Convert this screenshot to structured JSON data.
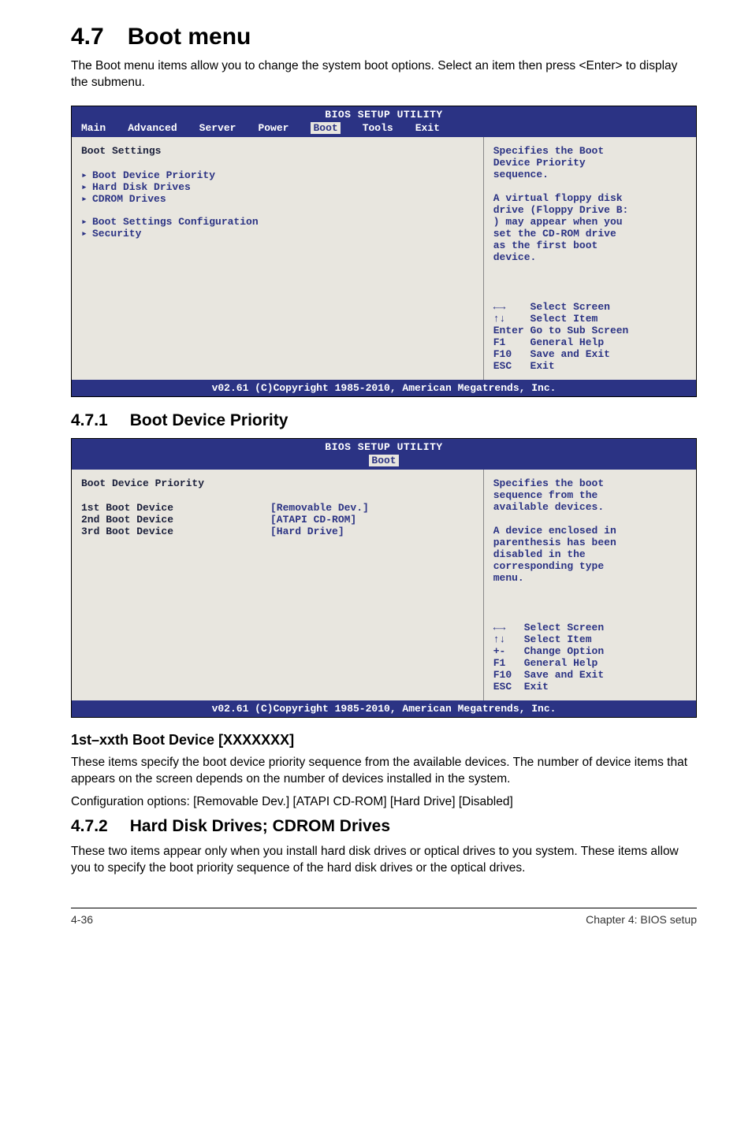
{
  "section": {
    "number": "4.7",
    "title": "Boot menu"
  },
  "intro": "The Boot menu items allow you to change the system boot options. Select an item then press <Enter> to display the submenu.",
  "bios1": {
    "title": "BIOS SETUP UTILITY",
    "tabs": [
      "Main",
      "Advanced",
      "Server",
      "Power",
      "Boot",
      "Tools",
      "Exit"
    ],
    "active_tab": "Boot",
    "left_heading": "Boot Settings",
    "items": [
      "Boot Device Priority",
      "Hard Disk Drives",
      "CDROM Drives",
      "",
      "Boot Settings Configuration",
      "Security"
    ],
    "help": "Specifies the Boot\nDevice Priority\nsequence.\n\nA virtual floppy disk\ndrive (Floppy Drive B:\n) may appear when you\nset the CD-ROM drive\nas the first boot\ndevice.",
    "keys": "←→    Select Screen\n↑↓    Select Item\nEnter Go to Sub Screen\nF1    General Help\nF10   Save and Exit\nESC   Exit",
    "footer": "v02.61 (C)Copyright 1985-2010, American Megatrends, Inc."
  },
  "sub1": {
    "number": "4.7.1",
    "title": "Boot Device Priority"
  },
  "bios2": {
    "title": "BIOS SETUP UTILITY",
    "tab": "Boot",
    "heading": "Boot Device Priority",
    "devices": [
      {
        "label": "1st Boot Device",
        "value": "[Removable Dev.]"
      },
      {
        "label": "2nd Boot Device",
        "value": "[ATAPI CD-ROM]"
      },
      {
        "label": "3rd Boot Device",
        "value": "[Hard Drive]"
      }
    ],
    "help": "Specifies the boot\nsequence from the\navailable devices.\n\nA device enclosed in\nparenthesis has been\ndisabled in the\ncorresponding type\nmenu.",
    "keys": "←→   Select Screen\n↑↓   Select Item\n+-   Change Option\nF1   General Help\nF10  Save and Exit\nESC  Exit",
    "footer": "v02.61 (C)Copyright 1985-2010, American Megatrends, Inc."
  },
  "subhead1": "1st–xxth Boot Device [XXXXXXX]",
  "para1": "These items specify the boot device priority sequence from the available devices. The number of device items that appears on the screen depends on the number of devices installed in the system.",
  "para2": "Configuration options: [Removable Dev.] [ATAPI CD-ROM] [Hard Drive] [Disabled]",
  "sub2": {
    "number": "4.7.2",
    "title": "Hard Disk Drives; CDROM Drives"
  },
  "para3": "These two items appear only when you install hard disk drives or optical drives to you system. These items allow you to specify the boot priority sequence of the hard disk drives or the optical drives.",
  "footer": {
    "left": "4-36",
    "right": "Chapter 4: BIOS setup"
  }
}
